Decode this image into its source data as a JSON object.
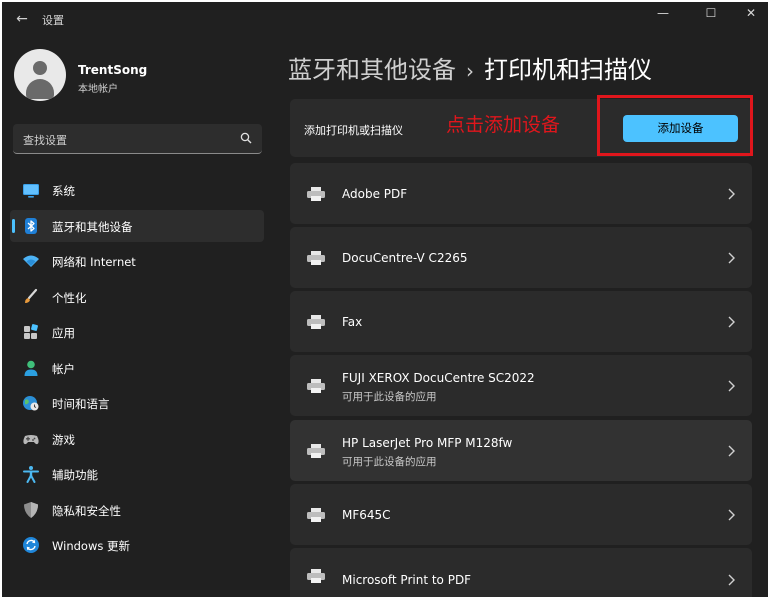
{
  "window": {
    "title": "设置",
    "controls": {
      "back": "←",
      "minimize": "—",
      "maximize": "☐",
      "close": "✕"
    }
  },
  "user": {
    "name": "TrentSong",
    "account_type": "本地帐户"
  },
  "search": {
    "placeholder": "查找设置",
    "icon": "search-icon"
  },
  "sidebar": {
    "items": [
      {
        "label": "系统",
        "icon": "monitor-icon",
        "active": false
      },
      {
        "label": "蓝牙和其他设备",
        "icon": "bluetooth-icon",
        "active": true
      },
      {
        "label": "网络和 Internet",
        "icon": "wifi-icon",
        "active": false
      },
      {
        "label": "个性化",
        "icon": "brush-icon",
        "active": false
      },
      {
        "label": "应用",
        "icon": "apps-icon",
        "active": false
      },
      {
        "label": "帐户",
        "icon": "person-icon",
        "active": false
      },
      {
        "label": "时间和语言",
        "icon": "globe-clock-icon",
        "active": false
      },
      {
        "label": "游戏",
        "icon": "gamepad-icon",
        "active": false
      },
      {
        "label": "辅助功能",
        "icon": "accessibility-icon",
        "active": false
      },
      {
        "label": "隐私和安全性",
        "icon": "shield-icon",
        "active": false
      },
      {
        "label": "Windows 更新",
        "icon": "update-icon",
        "active": false
      }
    ]
  },
  "breadcrumb": {
    "parent": "蓝牙和其他设备",
    "separator": "›",
    "current": "打印机和扫描仪"
  },
  "add_section": {
    "label": "添加打印机或扫描仪",
    "button_label": "添加设备",
    "annotation": "点击添加设备",
    "annotation_color": "#e0161c"
  },
  "printers": [
    {
      "name": "Adobe PDF",
      "subtitle": ""
    },
    {
      "name": "DocuCentre-V C2265",
      "subtitle": ""
    },
    {
      "name": "Fax",
      "subtitle": ""
    },
    {
      "name": "FUJI XEROX DocuCentre SC2022",
      "subtitle": "可用于此设备的应用"
    },
    {
      "name": "HP LaserJet Pro MFP M128fw",
      "subtitle": "可用于此设备的应用"
    },
    {
      "name": "MF645C",
      "subtitle": ""
    },
    {
      "name": "Microsoft Print to PDF",
      "subtitle": ""
    }
  ],
  "colors": {
    "accent": "#4cc2ff",
    "background": "#202020",
    "card": "#2b2b2b"
  }
}
